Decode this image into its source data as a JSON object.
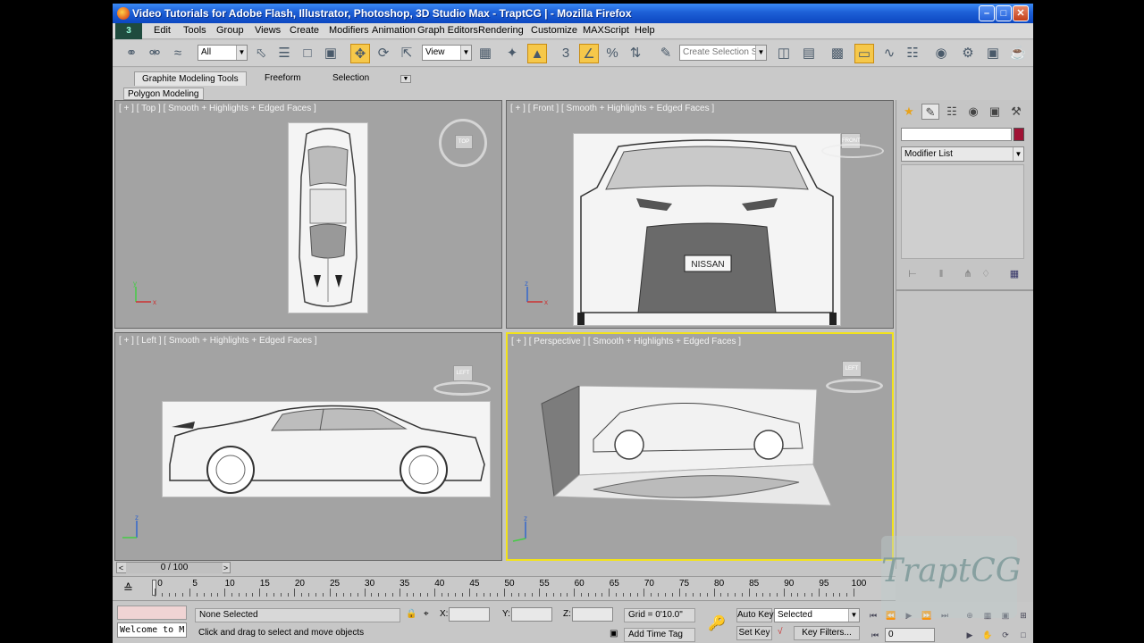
{
  "window": {
    "title": "Video Tutorials for Adobe Flash, Illustrator, Photoshop, 3D Studio Max - TraptCG | - Mozilla Firefox",
    "controls": [
      "minimize",
      "maximize",
      "close"
    ]
  },
  "menubar": {
    "items": [
      "Edit",
      "Tools",
      "Group",
      "Views",
      "Create",
      "Modifiers",
      "Animation",
      "Graph Editors",
      "Rendering",
      "Customize",
      "MAXScript",
      "Help"
    ]
  },
  "toolbar": {
    "selection_filter": "All",
    "ref_coord": "View",
    "selection_set_placeholder": "Create Selection Se"
  },
  "ribbon": {
    "tabs": [
      "Graphite Modeling Tools",
      "Freeform",
      "Selection"
    ],
    "active_tab": "Graphite Modeling Tools",
    "subtab": "Polygon Modeling"
  },
  "viewports": {
    "top": {
      "label": "[ + ] [ Top ] [ Smooth + Highlights + Edged Faces ]",
      "cube_face": "TOP"
    },
    "front": {
      "label": "[ + ] [ Front ] [ Smooth + Highlights + Edged Faces ]",
      "cube_face": "FRONT",
      "plate_text": "NISSAN"
    },
    "left": {
      "label": "[ + ] [ Left ] [ Smooth + Highlights + Edged Faces ]",
      "cube_face": "LEFT"
    },
    "perspective": {
      "label": "[ + ] [ Perspective ] [ Smooth + Highlights + Edged Faces ]",
      "cube_face": "LEFT",
      "selected": true
    }
  },
  "command_panel": {
    "tab_icons": [
      "create-icon",
      "modify-icon",
      "hierarchy-icon",
      "motion-icon",
      "display-icon",
      "utilities-icon"
    ],
    "modifier_list": "Modifier List",
    "swatch_color": "#a01235"
  },
  "timeline": {
    "frame_display": "0 / 100",
    "ticks": [
      0,
      5,
      10,
      15,
      20,
      25,
      30,
      35,
      40,
      45,
      50,
      55,
      60,
      65,
      70,
      75,
      80,
      85,
      90,
      95,
      100
    ]
  },
  "status": {
    "listener_text": "Welcome to M",
    "selection": "None Selected",
    "prompt": "Click and drag to select and move objects",
    "x_label": "X:",
    "y_label": "Y:",
    "z_label": "Z:",
    "grid": "Grid = 0'10.0\"",
    "add_time_tag": "Add Time Tag",
    "auto_key": "Auto Key",
    "key_mode": "Selected",
    "set_key": "Set Key",
    "key_filters": "Key Filters...",
    "current_frame": "0"
  },
  "watermark": "TraptCG"
}
